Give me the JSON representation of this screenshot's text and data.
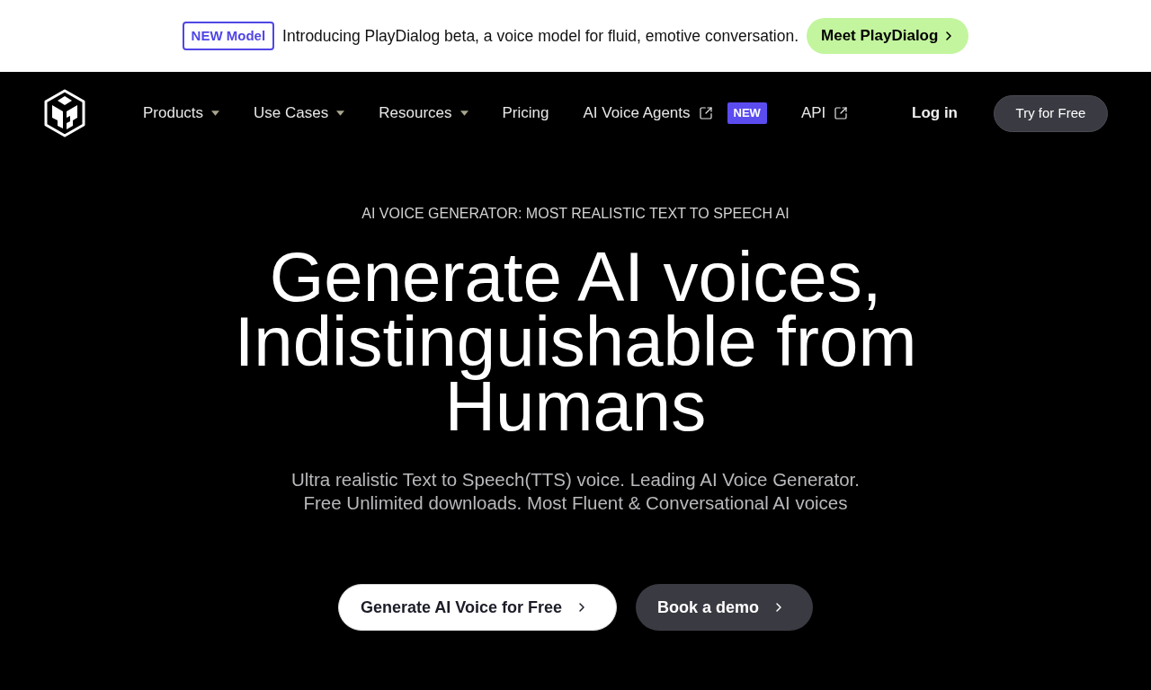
{
  "announcement": {
    "badge": "NEW Model",
    "text": "Introducing PlayDialog beta, a voice model for fluid, emotive conversation.",
    "button": "Meet PlayDialog"
  },
  "nav": {
    "items": [
      {
        "label": "Products",
        "kind": "dropdown"
      },
      {
        "label": "Use Cases",
        "kind": "dropdown"
      },
      {
        "label": "Resources",
        "kind": "dropdown"
      },
      {
        "label": "Pricing",
        "kind": "plain"
      },
      {
        "label": "AI Voice Agents",
        "kind": "external",
        "badge": "NEW"
      },
      {
        "label": "API",
        "kind": "external"
      }
    ],
    "login": "Log in",
    "cta": "Try for Free"
  },
  "hero": {
    "eyebrow": "AI VOICE GENERATOR: MOST REALISTIC TEXT TO SPEECH AI",
    "title_lines": [
      "Generate AI voices,",
      "Indistinguishable from",
      "Humans"
    ],
    "subtitle_lines": [
      "Ultra realistic Text to Speech(TTS) voice. Leading AI Voice Generator.",
      "Free Unlimited downloads. Most Fluent & Conversational AI voices"
    ],
    "buttons": [
      {
        "label": "Generate AI Voice for Free",
        "kind": "primary"
      },
      {
        "label": "Book a demo",
        "kind": "secondary"
      }
    ]
  }
}
